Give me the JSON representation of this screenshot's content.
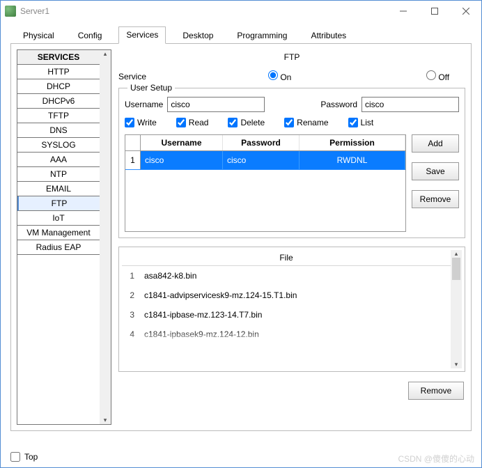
{
  "window": {
    "title": "Server1"
  },
  "tabs": [
    "Physical",
    "Config",
    "Services",
    "Desktop",
    "Programming",
    "Attributes"
  ],
  "active_tab": "Services",
  "sidebar": {
    "header": "SERVICES",
    "items": [
      "HTTP",
      "DHCP",
      "DHCPv6",
      "TFTP",
      "DNS",
      "SYSLOG",
      "AAA",
      "NTP",
      "EMAIL",
      "FTP",
      "IoT",
      "VM Management",
      "Radius EAP"
    ],
    "selected": "FTP"
  },
  "panel": {
    "title": "FTP",
    "service_label": "Service",
    "on_label": "On",
    "off_label": "Off",
    "user_setup_legend": "User Setup",
    "username_label": "Username",
    "password_label": "Password",
    "username_value": "cisco",
    "password_value": "cisco",
    "perm_write": "Write",
    "perm_read": "Read",
    "perm_delete": "Delete",
    "perm_rename": "Rename",
    "perm_list": "List",
    "col_user": "Username",
    "col_pass": "Password",
    "col_perm": "Permission",
    "rows": [
      {
        "n": "1",
        "user": "cisco",
        "pass": "cisco",
        "perm": "RWDNL"
      }
    ],
    "btn_add": "Add",
    "btn_save": "Save",
    "btn_remove": "Remove",
    "file_header": "File",
    "files": [
      {
        "n": "1",
        "name": "asa842-k8.bin"
      },
      {
        "n": "2",
        "name": "c1841-advipservicesk9-mz.124-15.T1.bin"
      },
      {
        "n": "3",
        "name": "c1841-ipbase-mz.123-14.T7.bin"
      }
    ],
    "file_truncated": "c1841-ipbasek9-mz.124-12.bin",
    "file_truncated_n": "4",
    "btn_file_remove": "Remove"
  },
  "footer": {
    "top": "Top"
  },
  "watermark": "CSDN @傻傻的心动"
}
